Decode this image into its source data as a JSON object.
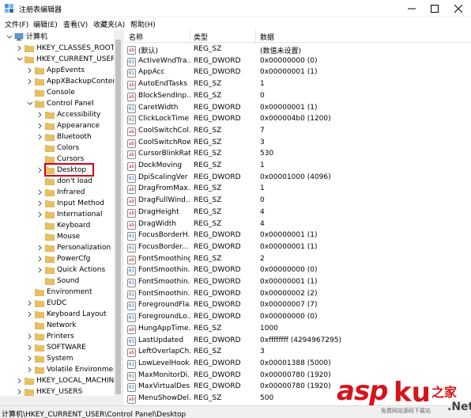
{
  "window": {
    "title": "注册表编辑器",
    "minimize_label": "minimize",
    "maximize_label": "maximize",
    "close_label": "close"
  },
  "menu": [
    "文件(F)",
    "编辑(E)",
    "查看(V)",
    "收藏夹(A)",
    "帮助(H)"
  ],
  "tree": [
    {
      "label": "计算机",
      "level": 0,
      "expanded": true,
      "has_arrow": true,
      "icon": "computer-icon"
    },
    {
      "label": "HKEY_CLASSES_ROOT",
      "level": 1,
      "expanded": false,
      "has_arrow": true,
      "icon": "folder-icon"
    },
    {
      "label": "HKEY_CURRENT_USER",
      "level": 1,
      "expanded": true,
      "has_arrow": true,
      "icon": "folder-icon"
    },
    {
      "label": "AppEvents",
      "level": 2,
      "expanded": false,
      "has_arrow": true,
      "icon": "folder-icon"
    },
    {
      "label": "AppXBackupContent",
      "level": 2,
      "expanded": false,
      "has_arrow": true,
      "icon": "folder-icon"
    },
    {
      "label": "Console",
      "level": 2,
      "expanded": false,
      "has_arrow": false,
      "icon": "folder-icon"
    },
    {
      "label": "Control Panel",
      "level": 2,
      "expanded": true,
      "has_arrow": true,
      "icon": "folder-icon"
    },
    {
      "label": "Accessibility",
      "level": 3,
      "expanded": false,
      "has_arrow": true,
      "icon": "folder-icon"
    },
    {
      "label": "Appearance",
      "level": 3,
      "expanded": false,
      "has_arrow": true,
      "icon": "folder-icon"
    },
    {
      "label": "Bluetooth",
      "level": 3,
      "expanded": false,
      "has_arrow": true,
      "icon": "folder-icon"
    },
    {
      "label": "Colors",
      "level": 3,
      "expanded": false,
      "has_arrow": false,
      "icon": "folder-icon"
    },
    {
      "label": "Cursors",
      "level": 3,
      "expanded": false,
      "has_arrow": false,
      "icon": "folder-icon"
    },
    {
      "label": "Desktop",
      "level": 3,
      "expanded": false,
      "has_arrow": true,
      "icon": "folder-icon",
      "selected": true
    },
    {
      "label": "don't load",
      "level": 3,
      "expanded": false,
      "has_arrow": false,
      "icon": "folder-icon"
    },
    {
      "label": "Infrared",
      "level": 3,
      "expanded": false,
      "has_arrow": true,
      "icon": "folder-icon"
    },
    {
      "label": "Input Method",
      "level": 3,
      "expanded": false,
      "has_arrow": true,
      "icon": "folder-icon"
    },
    {
      "label": "International",
      "level": 3,
      "expanded": false,
      "has_arrow": true,
      "icon": "folder-icon"
    },
    {
      "label": "Keyboard",
      "level": 3,
      "expanded": false,
      "has_arrow": false,
      "icon": "folder-icon"
    },
    {
      "label": "Mouse",
      "level": 3,
      "expanded": false,
      "has_arrow": false,
      "icon": "folder-icon"
    },
    {
      "label": "Personalization",
      "level": 3,
      "expanded": false,
      "has_arrow": true,
      "icon": "folder-icon"
    },
    {
      "label": "PowerCfg",
      "level": 3,
      "expanded": false,
      "has_arrow": true,
      "icon": "folder-icon"
    },
    {
      "label": "Quick Actions",
      "level": 3,
      "expanded": false,
      "has_arrow": true,
      "icon": "folder-icon"
    },
    {
      "label": "Sound",
      "level": 3,
      "expanded": false,
      "has_arrow": false,
      "icon": "folder-icon"
    },
    {
      "label": "Environment",
      "level": 2,
      "expanded": false,
      "has_arrow": false,
      "icon": "folder-icon"
    },
    {
      "label": "EUDC",
      "level": 2,
      "expanded": false,
      "has_arrow": true,
      "icon": "folder-icon"
    },
    {
      "label": "Keyboard Layout",
      "level": 2,
      "expanded": false,
      "has_arrow": true,
      "icon": "folder-icon"
    },
    {
      "label": "Network",
      "level": 2,
      "expanded": false,
      "has_arrow": false,
      "icon": "folder-icon"
    },
    {
      "label": "Printers",
      "level": 2,
      "expanded": false,
      "has_arrow": true,
      "icon": "folder-icon"
    },
    {
      "label": "SOFTWARE",
      "level": 2,
      "expanded": false,
      "has_arrow": true,
      "icon": "folder-icon"
    },
    {
      "label": "System",
      "level": 2,
      "expanded": false,
      "has_arrow": true,
      "icon": "folder-icon"
    },
    {
      "label": "Volatile Environment",
      "level": 2,
      "expanded": false,
      "has_arrow": true,
      "icon": "folder-icon"
    },
    {
      "label": "HKEY_LOCAL_MACHINE",
      "level": 1,
      "expanded": false,
      "has_arrow": true,
      "icon": "folder-icon"
    },
    {
      "label": "HKEY_USERS",
      "level": 1,
      "expanded": false,
      "has_arrow": true,
      "icon": "folder-icon"
    }
  ],
  "columns": {
    "name": "名称",
    "type": "类型",
    "data": "数据"
  },
  "values": [
    {
      "name": "(默认)",
      "type": "REG_SZ",
      "data": "(数值未设置)"
    },
    {
      "name": "ActiveWndTra...",
      "type": "REG_DWORD",
      "data": "0x00000000 (0)"
    },
    {
      "name": "AppAcc",
      "type": "REG_DWORD",
      "data": "0x00000001 (1)"
    },
    {
      "name": "AutoEndTasks",
      "type": "REG_SZ",
      "data": "1"
    },
    {
      "name": "BlockSendInp...",
      "type": "REG_SZ",
      "data": "0"
    },
    {
      "name": "CaretWidth",
      "type": "REG_DWORD",
      "data": "0x00000001 (1)"
    },
    {
      "name": "ClickLockTime",
      "type": "REG_DWORD",
      "data": "0x000004b0 (1200)"
    },
    {
      "name": "CoolSwitchCol...",
      "type": "REG_SZ",
      "data": "7"
    },
    {
      "name": "CoolSwitchRows",
      "type": "REG_SZ",
      "data": "3"
    },
    {
      "name": "CursorBlinkRate",
      "type": "REG_SZ",
      "data": "530"
    },
    {
      "name": "DockMoving",
      "type": "REG_SZ",
      "data": "1"
    },
    {
      "name": "DpiScalingVer",
      "type": "REG_DWORD",
      "data": "0x00001000 (4096)"
    },
    {
      "name": "DragFromMax...",
      "type": "REG_SZ",
      "data": "1"
    },
    {
      "name": "DragFullWind...",
      "type": "REG_SZ",
      "data": "0"
    },
    {
      "name": "DragHeight",
      "type": "REG_SZ",
      "data": "4"
    },
    {
      "name": "DragWidth",
      "type": "REG_SZ",
      "data": "4"
    },
    {
      "name": "FocusBorderH...",
      "type": "REG_DWORD",
      "data": "0x00000001 (1)"
    },
    {
      "name": "FocusBorder...",
      "type": "REG_DWORD",
      "data": "0x00000001 (1)"
    },
    {
      "name": "FontSmoothing",
      "type": "REG_SZ",
      "data": "2"
    },
    {
      "name": "FontSmoothin...",
      "type": "REG_DWORD",
      "data": "0x00000000 (0)"
    },
    {
      "name": "FontSmoothin...",
      "type": "REG_DWORD",
      "data": "0x00000001 (1)"
    },
    {
      "name": "FontSmoothin...",
      "type": "REG_DWORD",
      "data": "0x00000002 (2)"
    },
    {
      "name": "ForegroundFla...",
      "type": "REG_DWORD",
      "data": "0x00000007 (7)"
    },
    {
      "name": "ForegroundLo...",
      "type": "REG_DWORD",
      "data": "0x00000000 (0)"
    },
    {
      "name": "HungAppTime...",
      "type": "REG_SZ",
      "data": "1000"
    },
    {
      "name": "LastUpdated",
      "type": "REG_DWORD",
      "data": "0xffffffff (4294967295)"
    },
    {
      "name": "LeftOverlapCh...",
      "type": "REG_SZ",
      "data": "3"
    },
    {
      "name": "LowLevelHook...",
      "type": "REG_DWORD",
      "data": "0x00001388 (5000)"
    },
    {
      "name": "MaxMonitorDi...",
      "type": "REG_DWORD",
      "data": "0x00000780 (1920)"
    },
    {
      "name": "MaxVirtualDes...",
      "type": "REG_DWORD",
      "data": "0x00000780 (1920)"
    },
    {
      "name": "MenuShowDel...",
      "type": "REG_SZ",
      "data": "500"
    }
  ],
  "status": {
    "path": "计算机\\HKEY_CURRENT_USER\\Control Panel\\Desktop"
  },
  "watermark": {
    "main": "asp",
    "tail": "ku",
    "cn": "之家",
    "net": ".Net",
    "sub": "免费网站源码下载站"
  },
  "colors": {
    "selection_box": "#d0021b",
    "watermark": "#d6141b",
    "folder": "#e8c062"
  }
}
